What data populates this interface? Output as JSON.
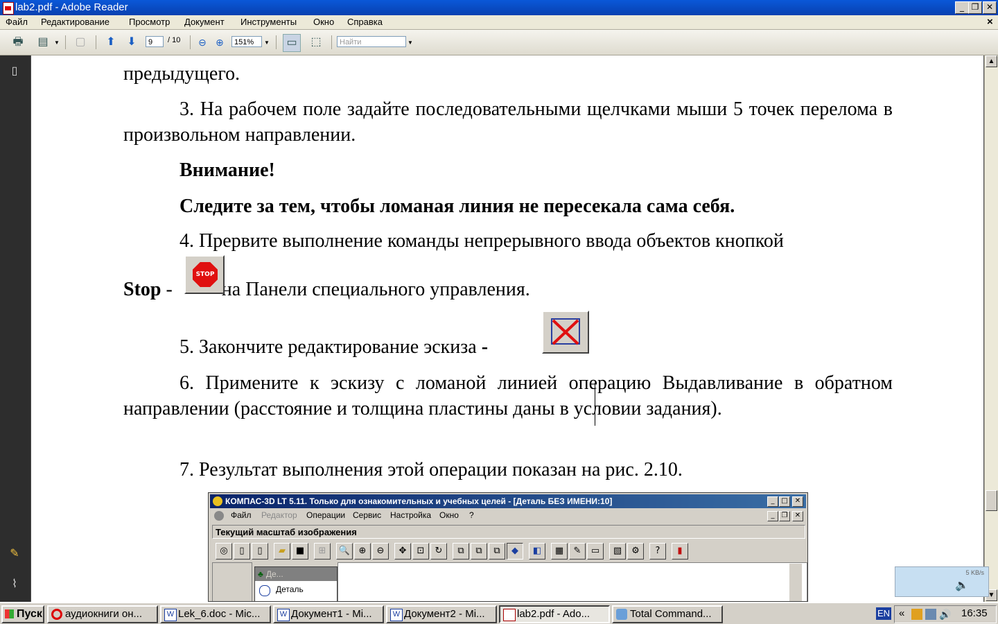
{
  "window": {
    "title": "lab2.pdf - Adobe Reader",
    "min": "_",
    "max": "❐",
    "close": "✕",
    "doc_close": "×"
  },
  "menu": [
    "Файл",
    "Редактирование",
    "Просмотр",
    "Документ",
    "Инструменты",
    "Окно",
    "Справка"
  ],
  "toolbar": {
    "page_current": "9",
    "page_total": "/ 10",
    "zoom": "151%",
    "search_placeholder": "Найти"
  },
  "document": {
    "line_top": "предыдущего.",
    "p3": "3. На рабочем поле задайте последовательными щелчками мыши 5 точек перелома в произвольном направлении.",
    "attention": "Внимание!",
    "warning": "Следите за тем, чтобы ломаная линия не пересекала сама себя.",
    "p4": "4. Прервите выполнение команды непрерывного ввода объектов кнопкой",
    "p4_stop": "Stop",
    "p4_dash": " - ",
    "p4_rest": "на Панели специального управления.",
    "stop_icon_text": "STOP",
    "p5": "5. Закончите редактирование эскиза",
    "p5_dash": " - ",
    "p5_end": ".",
    "p6": "6. Примените к эскизу с ломаной линией операцию Выдавливание в обратном направлении (расстояние и толщина пластины даны в условии задания).",
    "p7": "7. Результат выполнения этой операции показан на рис. 2.10."
  },
  "kompas": {
    "title": "КОМПАС-3D LT 5.11. Только для ознакомительных и учебных целей - [Деталь БЕЗ ИМЕНИ:10]",
    "menu": [
      "Файл",
      "Редактор",
      "Операции",
      "Сервис",
      "Настройка",
      "Окно",
      "?"
    ],
    "status": "Текущий масштаб изображения",
    "tree_title": "Де...",
    "tree_item": "Деталь"
  },
  "speed_widget": "5 KB/s",
  "taskbar": {
    "start": "Пуск",
    "tasks": [
      "аудиокниги он...",
      "Lek_6.doc - Mic...",
      "Документ1 - Mi...",
      "Документ2 - Mi...",
      "lab2.pdf - Ado...",
      "Total Command..."
    ],
    "lang": "EN",
    "chevron": "«",
    "clock": "16:35"
  },
  "colors": {
    "titlebar": "#0a58d8",
    "taskbar": "#d4d0c8",
    "nav_panel": "#2d2d2d",
    "stop_red": "#e01010"
  }
}
